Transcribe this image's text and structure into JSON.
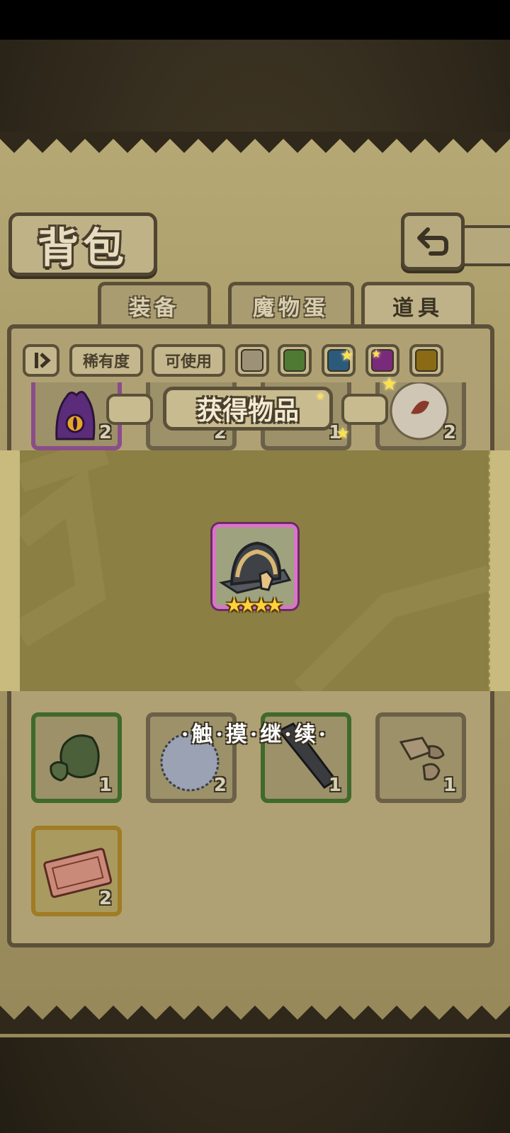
{
  "header": {
    "title": "背包"
  },
  "tabs": [
    {
      "label": "装备",
      "active": false
    },
    {
      "label": "魔物蛋",
      "active": false
    },
    {
      "label": "道具",
      "active": true
    }
  ],
  "filters": {
    "sort_icon": "sort-toggle-icon",
    "rarity_label": "稀有度",
    "usable_label": "可使用",
    "colors": [
      "#9d9277",
      "#4f7a33",
      "#2c5a7a",
      "#7a2a7a",
      "#8a6a14"
    ]
  },
  "popup": {
    "title": "获得物品",
    "item": {
      "icon": "helmet-icon",
      "stars": "★★★★",
      "rarity_color": "#d875c8"
    },
    "hint": "·触·摸·继·续·"
  },
  "inventory": {
    "top_row": [
      {
        "icon": "purple-monster-icon",
        "count": "2",
        "border": "#8a4d8a"
      },
      {
        "icon": "item-icon",
        "count": "2",
        "border": "#7a6f56"
      },
      {
        "icon": "item-icon",
        "count": "1",
        "border": "#7a6f56"
      },
      {
        "icon": "leaf-orb-icon",
        "count": "2",
        "border": "#7a6f56"
      }
    ],
    "row_2": [
      {
        "icon": "green-rock-icon",
        "count": "1",
        "border": "#3f6a2c"
      },
      {
        "icon": "fur-ball-icon",
        "count": "2",
        "border": "#6b6048"
      },
      {
        "icon": "dark-blade-icon",
        "count": "1",
        "border": "#3f6a2c"
      },
      {
        "icon": "stone-chunks-icon",
        "count": "1",
        "border": "#6b6048"
      }
    ],
    "row_3": [
      {
        "icon": "ticket-icon",
        "count": "2",
        "border": "#a07c24"
      }
    ]
  }
}
